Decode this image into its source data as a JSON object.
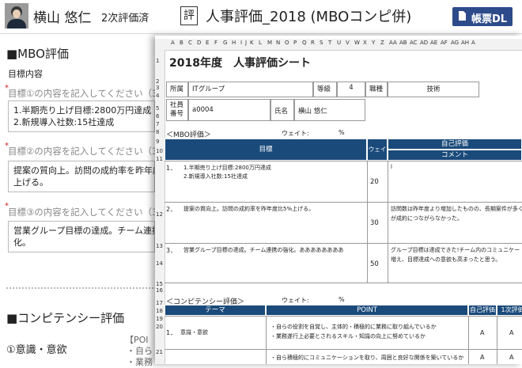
{
  "header": {
    "user_name": "横山 悠仁",
    "eval_status": "2次評価済",
    "doc_icon_char": "評",
    "doc_title": "人事評価_2018 (MBOコンピ併)",
    "download_label": "帳票DL"
  },
  "form": {
    "mbo_heading": "■MBO評価",
    "mbo_subheading": "目標内容",
    "goals": [
      {
        "placeholder": "目標①の内容を記入してください（300",
        "value": "1.半期売り上げ目標:2800万円達成\n2.新規導入社数:15社達成"
      },
      {
        "placeholder": "目標②の内容を記入してください（300",
        "value": "提案の質向上。訪問の成約率を昨年度\n上げる。"
      },
      {
        "placeholder": "目標③の内容を記入してください（300",
        "value": "営業グループ目標の達成。チーム連携\n化。"
      }
    ],
    "competency_heading": "■コンピテンシー評価",
    "competency_item": "①意識・意欲",
    "partial_texts": [
      "【POI",
      "・自ら",
      "・業務"
    ]
  },
  "sheet": {
    "columns": [
      "A",
      "B",
      "C",
      "D",
      "E",
      "F",
      "G",
      "H",
      "I",
      "J",
      "K",
      "L",
      "M",
      "N",
      "O",
      "P",
      "Q",
      "R",
      "S",
      "T",
      "U",
      "V",
      "W",
      "X",
      "Y",
      "Z",
      "AA",
      "AB",
      "AC",
      "AD",
      "AE",
      "AF",
      "AG",
      "AH",
      "A"
    ],
    "rows": [
      "1",
      "2",
      "3",
      "4",
      "5",
      "6",
      "7",
      "8",
      "9",
      "10",
      "11",
      "12",
      "13",
      "14",
      "15",
      "16",
      "17",
      "18",
      "19",
      "20",
      "21"
    ],
    "title": "2018年度　人事評価シート",
    "dept_label": "所属",
    "dept_value": "ITグループ",
    "grade_label": "等級",
    "grade_value": "4",
    "job_label": "職種",
    "job_value": "技術",
    "emp_no_label": "社員\n番号",
    "emp_no_value": "a0004",
    "name_label": "氏名",
    "name_value": "横山 悠仁",
    "mbo_section": "＜MBO評価＞",
    "weight_label": "ウェイト:",
    "percent": "%",
    "col_goal": "目標",
    "col_weight": "ウェイト",
    "col_self": "自己評価",
    "col_comment": "コメント",
    "goals": [
      {
        "num": "1．",
        "lines": [
          "1.半期売り上げ目標:2800万円達成",
          "2.新規導入社数:15社達成"
        ],
        "weight": "20",
        "comment": [
          "l"
        ]
      },
      {
        "num": "2．",
        "lines": [
          "提案の質向上。訪問の成約率を昨年度比5%上げる。"
        ],
        "weight": "30",
        "comment": [
          "訪問数は昨年度より増加したものの、長期案件が多く",
          "が成約につながらなかった。"
        ]
      },
      {
        "num": "3．",
        "lines": [
          "営業グループ目標の達成。チーム連携の強化。ああああああああ"
        ],
        "weight": "50",
        "comment": [
          "グループ目標は達成できた!チーム内のコミュニケー",
          "増え、目標達成への意欲も高まったと思う。"
        ]
      }
    ],
    "comp_section": "＜コンピテンシー評価＞",
    "col_theme": "テーマ",
    "col_point": "POINT",
    "col_self_eval": "自己評価",
    "col_first_eval": "1次評価",
    "comp_rows": [
      {
        "num": "1．",
        "theme": "意識・意欲",
        "points": [
          "・自らの役割を自覚し、主体的・積極的に業務に取り組んでいるか",
          "・業務遂行上必要とされるスキル・知識の向上に努めているか"
        ],
        "self": "A",
        "first": "A"
      },
      {
        "num": "",
        "theme": "",
        "points": [
          "・自ら積極的にコミュニケーションを取り、周囲と良好な関係を築いているか"
        ],
        "self": "A",
        "first": "A"
      }
    ]
  },
  "colors": {
    "header_blue": "#1a4a7a",
    "button_blue": "#2d4a8a",
    "required_red": "#d02020"
  }
}
